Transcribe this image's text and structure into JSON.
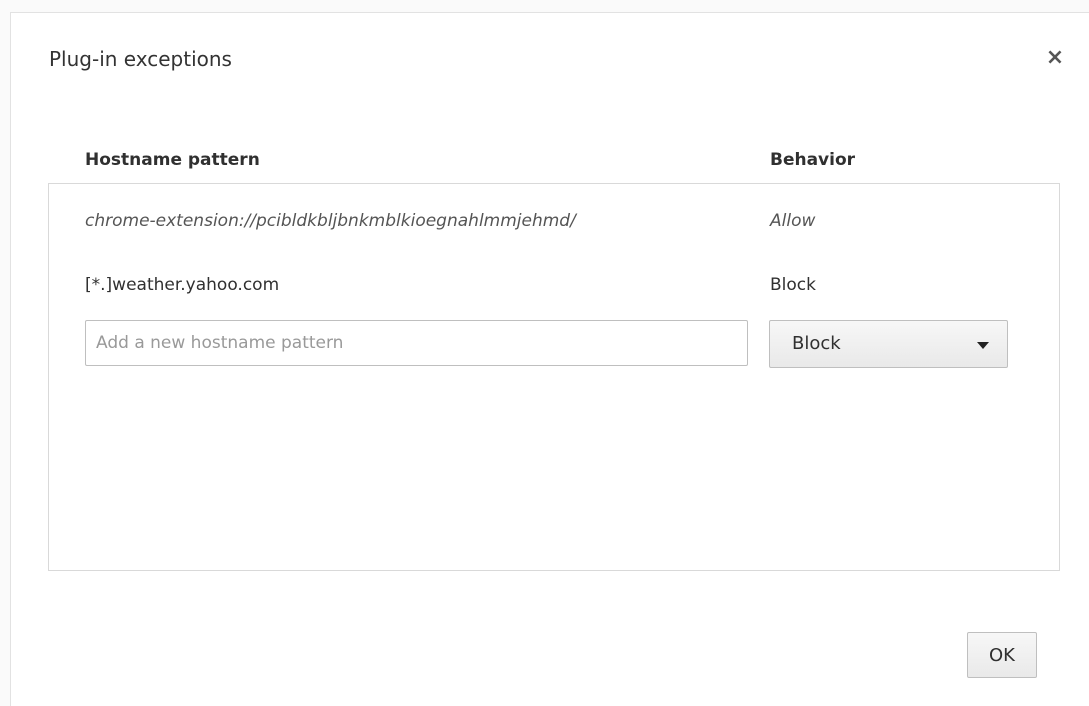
{
  "dialog": {
    "title": "Plug-in exceptions",
    "close_symbol": "×"
  },
  "table": {
    "headers": {
      "host": "Hostname pattern",
      "behavior": "Behavior"
    },
    "rows": [
      {
        "host": "chrome-extension://pcibldkbljbnkmblkioegnahlmmjehmd/",
        "behavior": "Allow",
        "style": "italic"
      },
      {
        "host": "[*.]weather.yahoo.com",
        "behavior": "Block",
        "style": "normal"
      }
    ]
  },
  "new_entry": {
    "placeholder": "Add a new hostname pattern",
    "value": "",
    "selected_behavior": "Block"
  },
  "footer": {
    "ok_label": "OK"
  },
  "colors": {
    "text": "#303030",
    "muted_text": "#555555",
    "border": "#d9d9d9"
  }
}
